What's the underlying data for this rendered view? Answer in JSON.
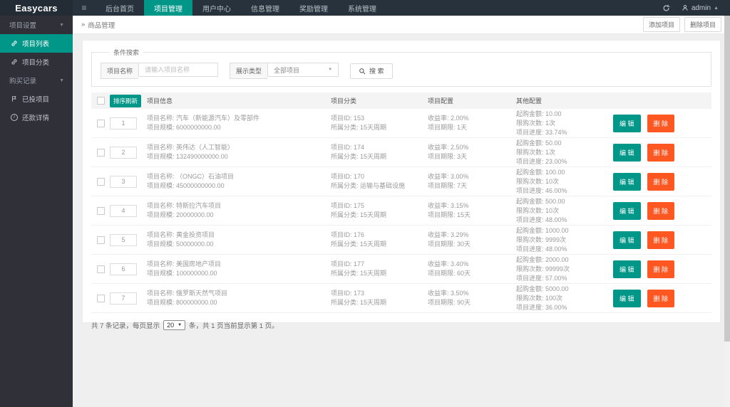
{
  "colors": {
    "accent": "#009688",
    "danger": "#ff5722",
    "topbar_bg": "#28323c",
    "sidebar_bg": "#2f3038"
  },
  "topbar": {
    "logo": "Easycars",
    "nav": [
      {
        "label": "后台首页"
      },
      {
        "label": "项目管理"
      },
      {
        "label": "用户中心"
      },
      {
        "label": "信息管理"
      },
      {
        "label": "奖励管理"
      },
      {
        "label": "系统管理"
      }
    ],
    "user": "admin"
  },
  "sidebar": {
    "groups": [
      {
        "label": "项目设置",
        "items": [
          {
            "label": "项目列表",
            "icon": "link-icon",
            "active": true
          },
          {
            "label": "项目分类",
            "icon": "link-icon",
            "active": false
          }
        ]
      },
      {
        "label": "购买记录",
        "items": [
          {
            "label": "已投项目",
            "icon": "flag-icon",
            "active": false
          },
          {
            "label": "还款详情",
            "icon": "info-icon",
            "active": false
          }
        ]
      }
    ]
  },
  "breadcrumb": {
    "prefix": "»",
    "title": "商品管理",
    "add_button": "添加项目",
    "delete_button": "删除项目"
  },
  "filter": {
    "legend": "条件搜索",
    "name_label": "项目名称",
    "name_placeholder": "请输入项目名称",
    "type_label": "展示类型",
    "type_value": "全部项目",
    "search_button": "搜 索"
  },
  "table": {
    "sort_button": "排序刷新",
    "headers": {
      "info": "项目信息",
      "category": "项目分类",
      "config": "项目配置",
      "other": "其他配置"
    },
    "edit_label": "编 辑",
    "delete_label": "删 除",
    "rows": [
      {
        "sort": "1",
        "name_line": "项目名称: 汽车（新能源汽车）及零部件",
        "scale_line": "项目规模: 6000000000.00",
        "id_line": "项目ID: 153",
        "category_line": "所属分类: 15天周期",
        "rate_line": "收益率: 2.00%",
        "term_line": "项目期限: 1天",
        "min_line": "起购金额: 10.00",
        "limit_line": "限购次数: 1次",
        "progress_line": "项目进度: 33.74%"
      },
      {
        "sort": "2",
        "name_line": "项目名称: 英伟达（人工智能）",
        "scale_line": "项目规模: 132490000000.00",
        "id_line": "项目ID: 174",
        "category_line": "所属分类: 15天周期",
        "rate_line": "收益率: 2.50%",
        "term_line": "项目期限: 3天",
        "min_line": "起购金额: 50.00",
        "limit_line": "限购次数: 1次",
        "progress_line": "项目进度: 23.00%"
      },
      {
        "sort": "3",
        "name_line": "项目名称: （ONGC）石油项目",
        "scale_line": "项目规模: 45000000000.00",
        "id_line": "项目ID: 170",
        "category_line": "所属分类: 运输与基础设施",
        "rate_line": "收益率: 3.00%",
        "term_line": "项目期限: 7天",
        "min_line": "起购金额: 100.00",
        "limit_line": "限购次数: 10次",
        "progress_line": "项目进度: 46.00%"
      },
      {
        "sort": "4",
        "name_line": "项目名称: 特斯拉汽车项目",
        "scale_line": "项目规模: 20000000.00",
        "id_line": "项目ID: 175",
        "category_line": "所属分类: 15天周期",
        "rate_line": "收益率: 3.15%",
        "term_line": "项目期限: 15天",
        "min_line": "起购金额: 500.00",
        "limit_line": "限购次数: 10次",
        "progress_line": "项目进度: 48.00%"
      },
      {
        "sort": "5",
        "name_line": "项目名称: 黄金投资项目",
        "scale_line": "项目规模: 50000000.00",
        "id_line": "项目ID: 176",
        "category_line": "所属分类: 15天周期",
        "rate_line": "收益率: 3.29%",
        "term_line": "项目期限: 30天",
        "min_line": "起购金额: 1000.00",
        "limit_line": "限购次数: 9999次",
        "progress_line": "项目进度: 48.00%"
      },
      {
        "sort": "6",
        "name_line": "项目名称: 美国房地产项目",
        "scale_line": "项目规模: 100000000.00",
        "id_line": "项目ID: 177",
        "category_line": "所属分类: 15天周期",
        "rate_line": "收益率: 3.40%",
        "term_line": "项目期限: 60天",
        "min_line": "起购金额: 2000.00",
        "limit_line": "限购次数: 99999次",
        "progress_line": "项目进度: 57.00%"
      },
      {
        "sort": "7",
        "name_line": "项目名称: 俄罗斯天然气项目",
        "scale_line": "项目规模: 800000000.00",
        "id_line": "项目ID: 173",
        "category_line": "所属分类: 15天周期",
        "rate_line": "收益率: 3.50%",
        "term_line": "项目期限: 90天",
        "min_line": "起购金额: 5000.00",
        "limit_line": "限购次数: 100次",
        "progress_line": "项目进度: 36.00%"
      }
    ]
  },
  "pagination": {
    "prefix": "共 7 条记录，每页显示",
    "page_size": "20",
    "suffix": "条，共 1 页当前显示第 1 页。"
  }
}
